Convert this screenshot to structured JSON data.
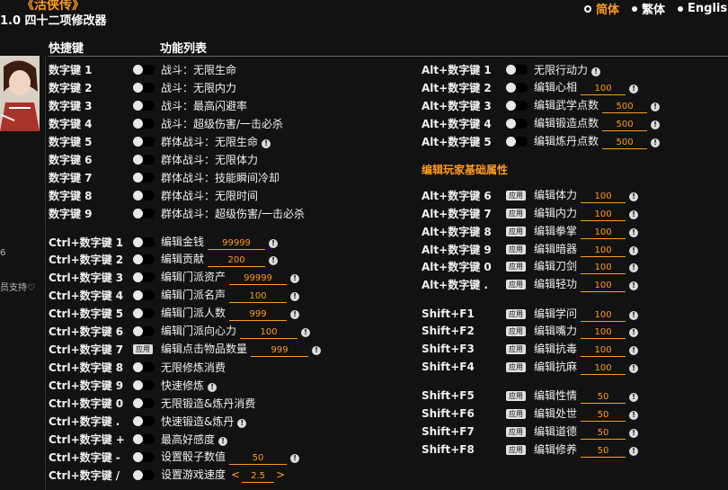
{
  "app": {
    "title": "《活侠传》",
    "subtitle": "1.0 四十二项修改器"
  },
  "languages": [
    {
      "label": "简体",
      "active": true
    },
    {
      "label": "繁体",
      "active": false
    },
    {
      "label": "English",
      "active": false
    }
  ],
  "headers": {
    "hotkey": "快捷键",
    "functions": "功能列表"
  },
  "side": {
    "note1": "6",
    "note2": "员支持♡"
  },
  "section_player": "编辑玩家基础属性",
  "apply_label": "应用",
  "stepper": {
    "prev": "<",
    "next": ">"
  },
  "left_rows": [
    {
      "key": "数字键 1",
      "label": "战斗：无限生命",
      "info": false
    },
    {
      "key": "数字键 2",
      "label": "战斗：无限内力",
      "info": false
    },
    {
      "key": "数字键 3",
      "label": "战斗：最高闪避率",
      "info": false
    },
    {
      "key": "数字键 4",
      "label": "战斗：超级伤害/一击必杀",
      "info": false
    },
    {
      "key": "数字键 5",
      "label": "群体战斗：无限生命",
      "info": true
    },
    {
      "key": "数字键 6",
      "label": "群体战斗：无限体力",
      "info": false
    },
    {
      "key": "数字键 7",
      "label": "群体战斗：技能瞬间冷却",
      "info": false
    },
    {
      "key": "数字键 8",
      "label": "群体战斗：无限时间",
      "info": false
    },
    {
      "key": "数字键 9",
      "label": "群体战斗：超级伤害/一击必杀",
      "info": false
    },
    {
      "key": "Ctrl+数字键 1",
      "label": "编辑金钱",
      "value": "99999",
      "info": true
    },
    {
      "key": "Ctrl+数字键 2",
      "label": "编辑贡献",
      "value": "200",
      "info": true
    },
    {
      "key": "Ctrl+数字键 3",
      "label": "编辑门派资产",
      "value": "99999",
      "info": true
    },
    {
      "key": "Ctrl+数字键 4",
      "label": "编辑门派名声",
      "value": "100",
      "info": true
    },
    {
      "key": "Ctrl+数字键 5",
      "label": "编辑门派人数",
      "value": "999",
      "info": true
    },
    {
      "key": "Ctrl+数字键 6",
      "label": "编辑门派向心力",
      "value": "100",
      "info": true
    },
    {
      "key": "Ctrl+数字键 7",
      "label": "编辑点击物品数量",
      "value": "999",
      "info": true,
      "apply": true
    },
    {
      "key": "Ctrl+数字键 8",
      "label": "无限修炼消费",
      "info": false
    },
    {
      "key": "Ctrl+数字键 9",
      "label": "快速修炼",
      "info": true
    },
    {
      "key": "Ctrl+数字键 0",
      "label": "无限锻造&炼丹消费",
      "info": false
    },
    {
      "key": "Ctrl+数字键 .",
      "label": "快速锻造&炼丹",
      "info": true
    },
    {
      "key": "Ctrl+数字键 +",
      "label": "最高好感度",
      "info": true
    },
    {
      "key": "Ctrl+数字键 -",
      "label": "设置骰子数值",
      "value": "50",
      "info": true
    },
    {
      "key": "Ctrl+数字键 /",
      "label": "设置游戏速度",
      "stepper_value": "2.5",
      "info": false
    }
  ],
  "right_rows": [
    {
      "key": "Alt+数字键 1",
      "label": "无限行动力",
      "info": true
    },
    {
      "key": "Alt+数字键 2",
      "label": "编辑心相",
      "value": "100",
      "info": true
    },
    {
      "key": "Alt+数字键 3",
      "label": "编辑武学点数",
      "value": "500",
      "info": true
    },
    {
      "key": "Alt+数字键 4",
      "label": "编辑锻造点数",
      "value": "500",
      "info": true
    },
    {
      "key": "Alt+数字键 5",
      "label": "编辑炼丹点数",
      "value": "500",
      "info": true
    },
    {
      "key": "Alt+数字键 6",
      "label": "编辑体力",
      "value": "100",
      "info": true,
      "apply": true
    },
    {
      "key": "Alt+数字键 7",
      "label": "编辑内力",
      "value": "100",
      "info": true,
      "apply": true
    },
    {
      "key": "Alt+数字键 8",
      "label": "编辑拳掌",
      "value": "100",
      "info": true,
      "apply": true
    },
    {
      "key": "Alt+数字键 9",
      "label": "编辑暗器",
      "value": "100",
      "info": true,
      "apply": true
    },
    {
      "key": "Alt+数字键 0",
      "label": "编辑刀剑",
      "value": "100",
      "info": true,
      "apply": true
    },
    {
      "key": "Alt+数字键 .",
      "label": "编辑轻功",
      "value": "100",
      "info": true,
      "apply": true
    },
    {
      "key": "Shift+F1",
      "label": "编辑学问",
      "value": "100",
      "info": true,
      "apply": true
    },
    {
      "key": "Shift+F2",
      "label": "编辑嘴力",
      "value": "100",
      "info": true,
      "apply": true
    },
    {
      "key": "Shift+F3",
      "label": "编辑抗毒",
      "value": "100",
      "info": true,
      "apply": true
    },
    {
      "key": "Shift+F4",
      "label": "编辑抗麻",
      "value": "100",
      "info": true,
      "apply": true
    },
    {
      "key": "Shift+F5",
      "label": "编辑性情",
      "value": "50",
      "info": true,
      "apply": true
    },
    {
      "key": "Shift+F6",
      "label": "编辑处世",
      "value": "50",
      "info": true,
      "apply": true
    },
    {
      "key": "Shift+F7",
      "label": "编辑道德",
      "value": "50",
      "info": true,
      "apply": true
    },
    {
      "key": "Shift+F8",
      "label": "编辑修养",
      "value": "50",
      "info": true,
      "apply": true
    }
  ]
}
